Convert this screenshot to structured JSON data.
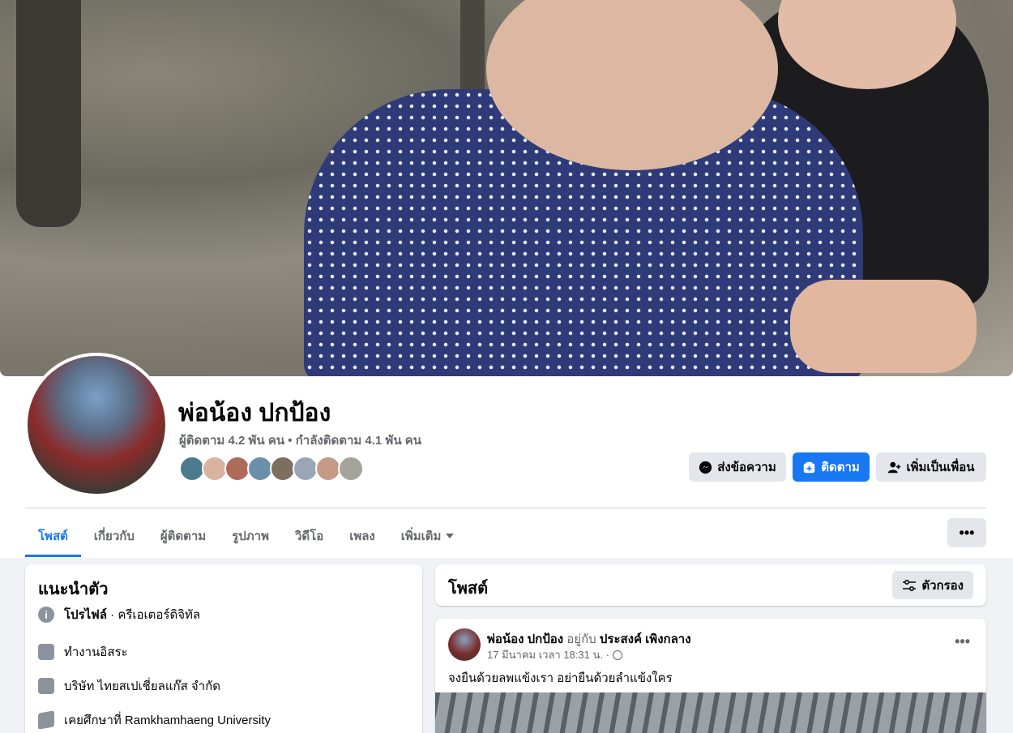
{
  "profile": {
    "name": "พ่อน้อง ปกป้อง",
    "stats": "ผู้ติดตาม 4.2 พัน คน • กำลังติดตาม 4.1 พัน คน",
    "friend_avatar_colors": [
      "#4b7a8c",
      "#d8b3a0",
      "#b06a5a",
      "#6a8fa8",
      "#7d6f5e",
      "#9aa6b8",
      "#c49a86",
      "#a6a39c"
    ]
  },
  "actions": {
    "message_label": "ส่งข้อความ",
    "follow_label": "ติดตาม",
    "add_friend_label": "เพิ่มเป็นเพื่อน"
  },
  "tabs": [
    {
      "label": "โพสต์",
      "active": true
    },
    {
      "label": "เกี่ยวกับ"
    },
    {
      "label": "ผู้ติดตาม"
    },
    {
      "label": "รูปภาพ"
    },
    {
      "label": "วิดีโอ"
    },
    {
      "label": "เพลง"
    },
    {
      "label": "เพิ่มเติม"
    }
  ],
  "more_label": "•••",
  "intro": {
    "title": "แนะนำตัว",
    "profile_strong": "โปรไฟล์",
    "profile_rest": " · ครีเอเตอร์ดิจิทัล",
    "work": "ทำงานอิสระ",
    "company": "บริษัท ไทยสเปเชี่ยลแก๊ส จำกัด",
    "education": "เคยศึกษาที่ Ramkhamhaeng University"
  },
  "posts": {
    "title": "โพสต์",
    "filter_label": "ตัวกรอง"
  },
  "post": {
    "author": "พ่อน้อง ปกป้อง",
    "with_word": " อยู่กับ ",
    "tagged": "ประสงค์ เพิงกลาง",
    "time": "17 มีนาคม เวลา 18:31 น. ·",
    "dots": "•••",
    "text": "จงยืนด้วยลพแข้งเรา อย่ายืนด้วยลำแข้งใคร"
  },
  "colors": {
    "accent": "#1877f2",
    "secondary_text": "#65676b",
    "button_gray": "#e4e6eb",
    "background": "#f0f2f5"
  }
}
